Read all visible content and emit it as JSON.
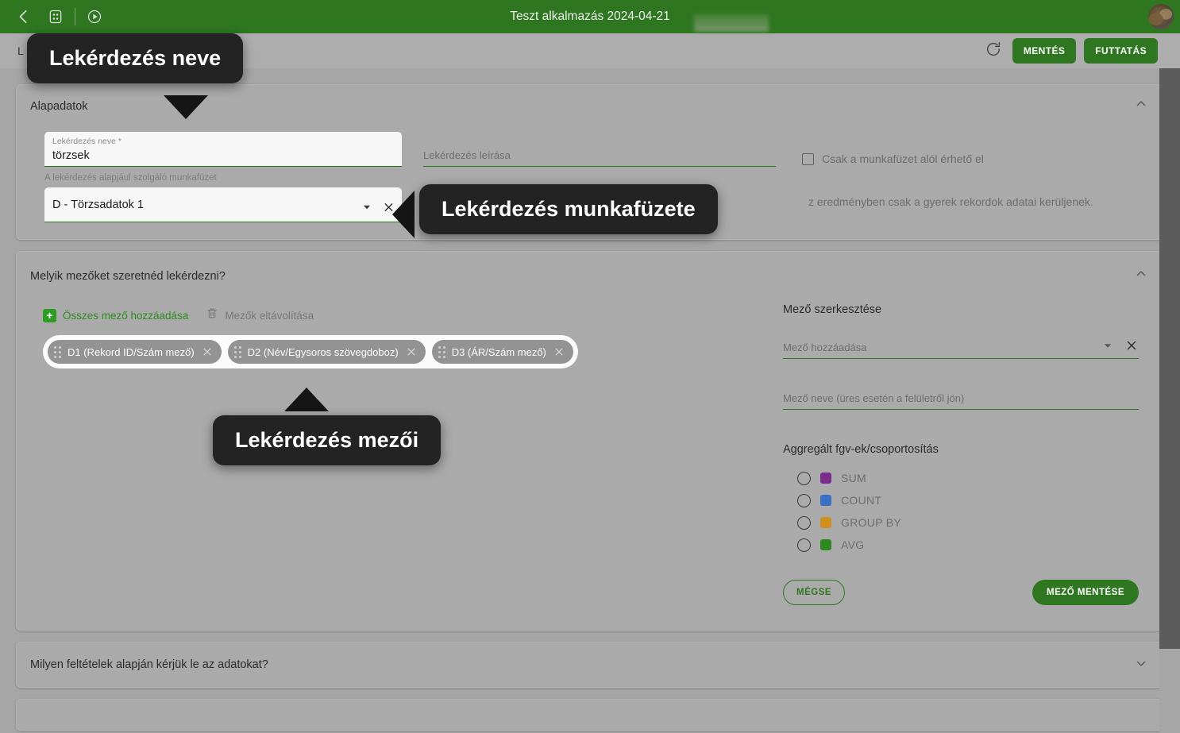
{
  "appbar": {
    "title": "Teszt alkalmazás 2024-04-21",
    "back_icon": "chevron-left-icon",
    "apps_icon": "apps-grid-icon",
    "play_icon": "play-circle-icon",
    "avatar": "user-avatar",
    "redacted": ""
  },
  "toolbar": {
    "tab_label": "L",
    "refresh_icon": "refresh-icon",
    "save_label": "MENTÉS",
    "run_label": "FUTTATÁS"
  },
  "basic": {
    "title": "Alapadatok",
    "collapse_icon": "chevron-up-icon",
    "name_label": "Lekérdezés neve *",
    "name_value": "törzsek",
    "description_placeholder": "Lekérdezés leírása",
    "checkbox_label": "Csak a munkafüzet alól érhető el",
    "workbook_label": "A lekérdezés alapjául szolgáló munkafüzet",
    "workbook_value": "D - Törzsadatok 1",
    "hint_text": "z eredményben csak a gyerek rekordok adatai kerüljenek.",
    "dropdown_icon": "chevron-down-icon",
    "clear_icon": "close-icon"
  },
  "fields": {
    "title": "Melyik mezőket szeretnéd lekérdezni?",
    "collapse_icon": "chevron-up-icon",
    "add_all_label": "Összes mező hozzáadása",
    "remove_label": "Mezők eltávolítása",
    "add_icon": "plus-square-icon",
    "trash_icon": "trash-icon",
    "chips": [
      {
        "label": "D1 (Rekord ID/Szám mező)"
      },
      {
        "label": "D2 (Név/Egysoros szövegdoboz)"
      },
      {
        "label": "D3 (ÁR/Szám mező)"
      }
    ]
  },
  "editor": {
    "title": "Mező szerkesztése",
    "add_field_placeholder": "Mező hozzáadása",
    "field_name_placeholder": "Mező neve (üres esetén a felületről jön)",
    "dropdown_icon": "chevron-down-icon",
    "clear_icon": "close-icon",
    "agg_title": "Aggregált fgv-ek/csoportosítás",
    "agg_options": [
      {
        "label": "SUM",
        "color": "#7b2d8e"
      },
      {
        "label": "COUNT",
        "color": "#3a6fc4"
      },
      {
        "label": "GROUP BY",
        "color": "#d1901e"
      },
      {
        "label": "AVG",
        "color": "#2e8a20"
      }
    ],
    "cancel_label": "MÉGSE",
    "save_label": "MEZŐ MENTÉSE"
  },
  "conditions": {
    "title": "Milyen feltételek alapján kérjük le az adatokat?",
    "expand_icon": "chevron-down-icon"
  },
  "tooltips": {
    "name": "Lekérdezés neve",
    "workbook": "Lekérdezés munkafüzete",
    "fields": "Lekérdezés mezői"
  },
  "colors": {
    "brand_green": "#2e7720",
    "page_bg": "#a6a6a6",
    "tooltip_bg": "#232323"
  }
}
